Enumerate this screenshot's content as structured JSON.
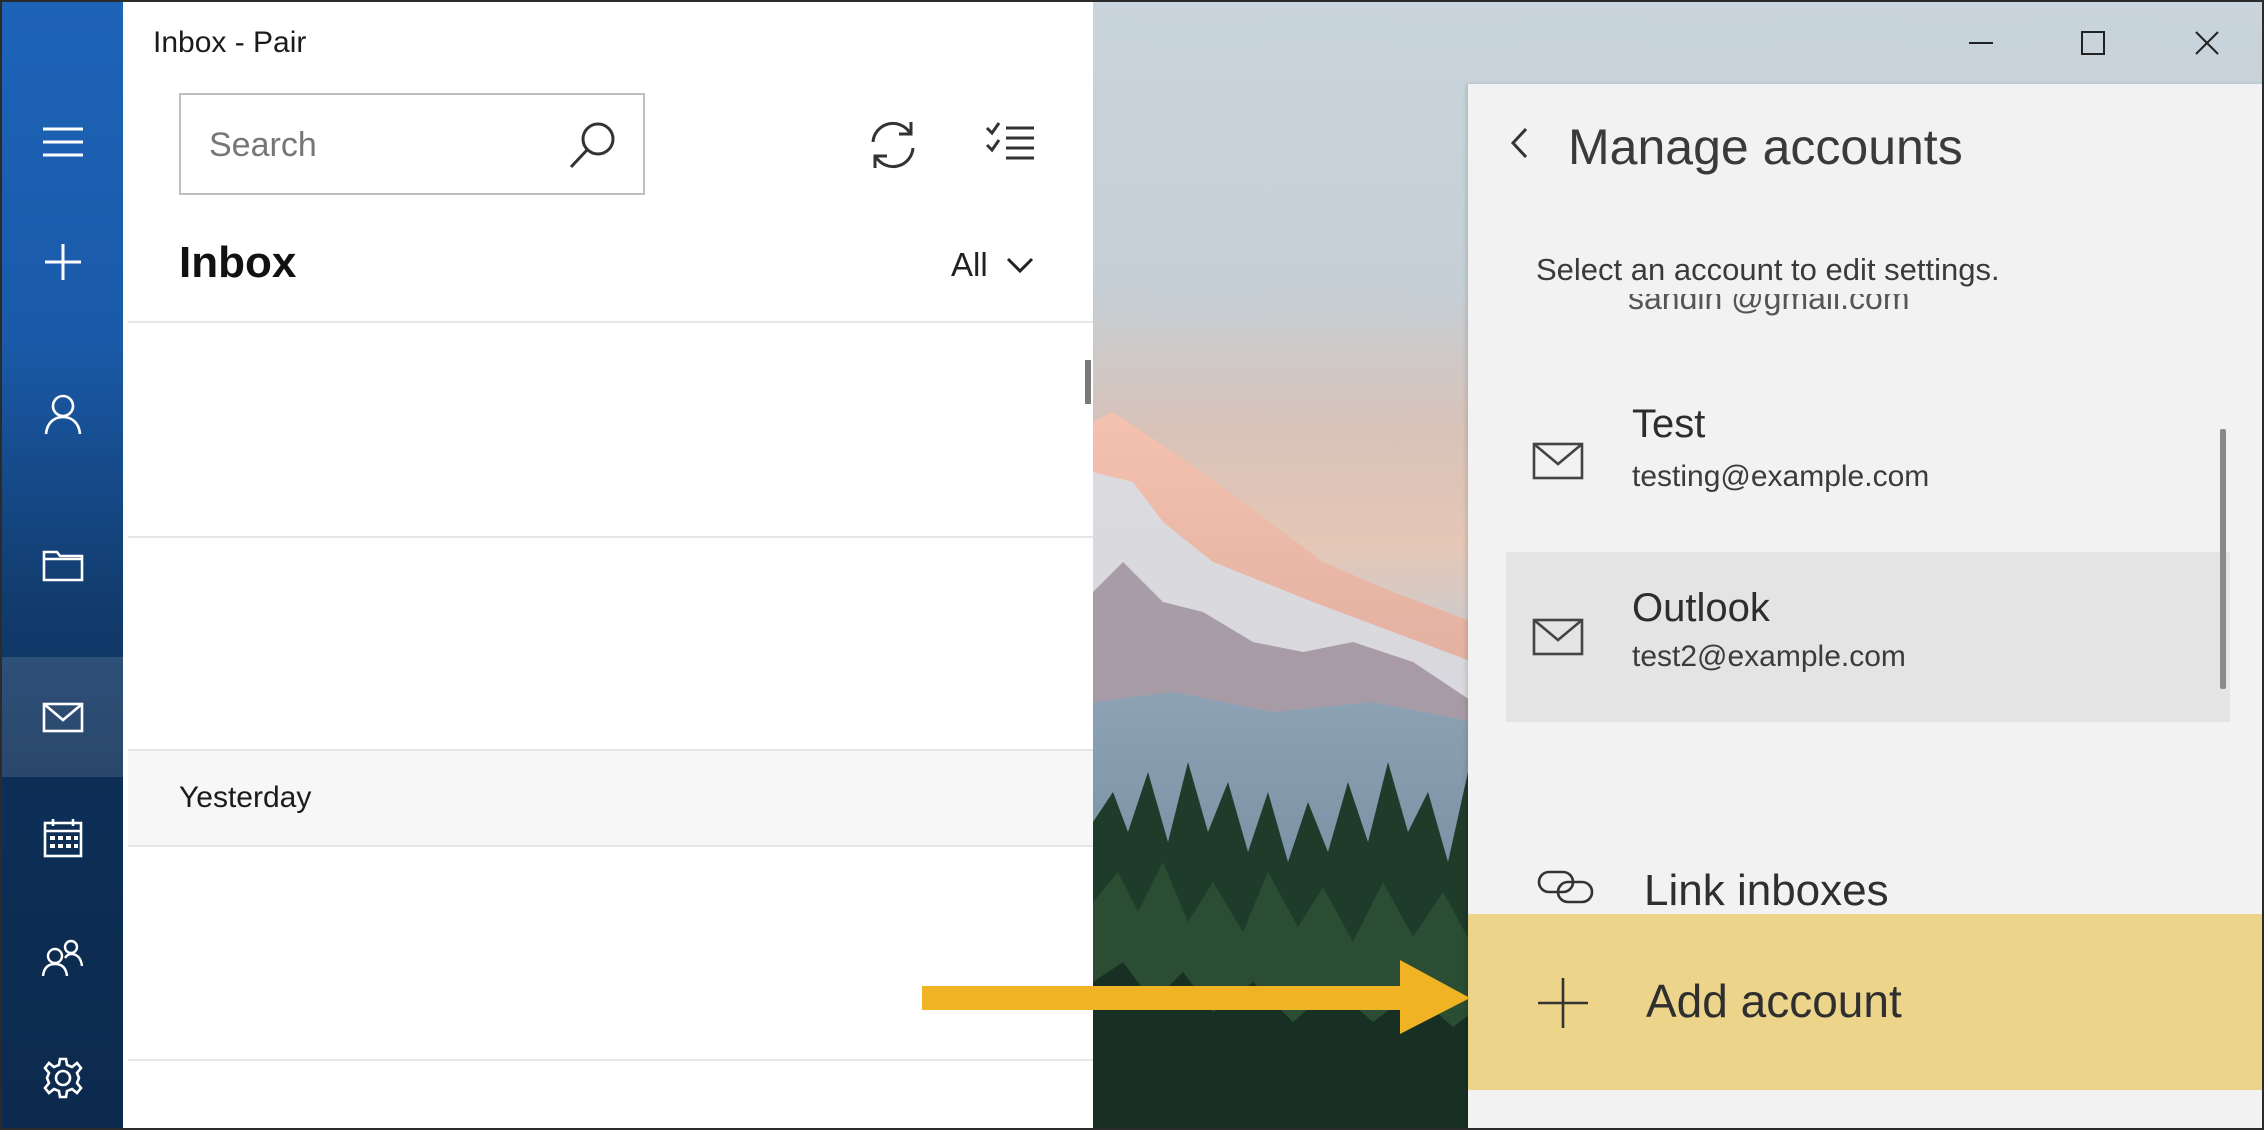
{
  "window": {
    "title": "Inbox - Pair",
    "controls": [
      "minimize",
      "maximize",
      "close"
    ]
  },
  "nav_rail": {
    "items": [
      {
        "icon": "hamburger-menu-icon",
        "selected": false
      },
      {
        "icon": "compose-plus-icon",
        "selected": false
      },
      {
        "icon": "person-icon",
        "selected": false
      },
      {
        "icon": "folder-icon",
        "selected": false
      },
      {
        "icon": "mail-icon",
        "selected": true
      },
      {
        "icon": "calendar-icon",
        "selected": false
      },
      {
        "icon": "people-icon",
        "selected": false
      },
      {
        "icon": "gear-icon",
        "selected": false
      }
    ]
  },
  "message_list": {
    "search": {
      "placeholder": "Search",
      "value": ""
    },
    "heading": "Inbox",
    "filter": {
      "selected": "All"
    },
    "groups": [
      {
        "label": "Yesterday"
      }
    ]
  },
  "manage_accounts": {
    "title": "Manage accounts",
    "subtitle": "Select an account to edit settings.",
    "partial_email": "sahdin @gmail.com",
    "accounts": [
      {
        "name": "Test",
        "email": "testing@example.com",
        "selected": false
      },
      {
        "name": "Outlook",
        "email": "test2@example.com",
        "selected": true
      }
    ],
    "link_inboxes_label": "Link inboxes",
    "add_account_label": "Add account"
  },
  "colors": {
    "rail_blue": "#1d63b8",
    "highlight_yellow": "#ecd48b",
    "arrow_orange": "#f0b323",
    "flyout_bg": "#f2f2f2"
  }
}
